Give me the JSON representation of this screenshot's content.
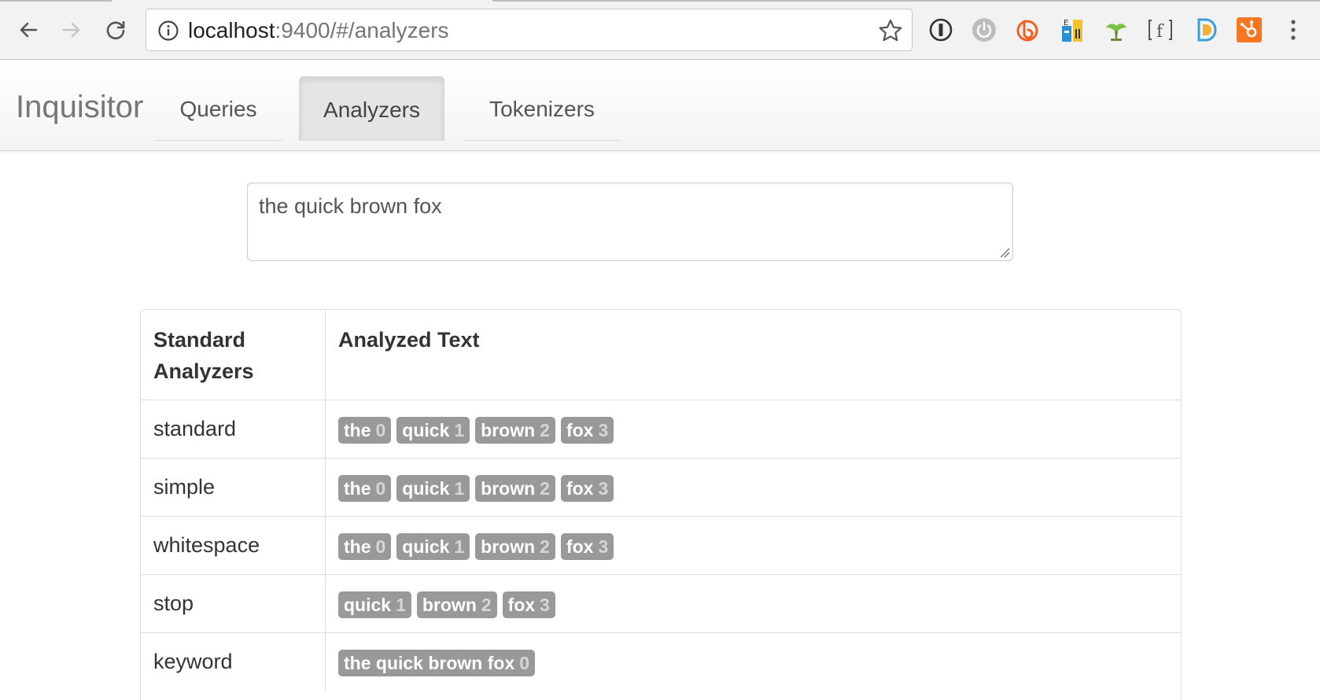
{
  "browser": {
    "url_host": "localhost",
    "url_rest": ":9400/#/analyzers"
  },
  "app": {
    "brand": "Inquisitor",
    "nav": [
      {
        "label": "Queries",
        "active": false
      },
      {
        "label": "Analyzers",
        "active": true
      },
      {
        "label": "Tokenizers",
        "active": false
      }
    ]
  },
  "query": {
    "text": "the quick brown fox"
  },
  "table": {
    "headers": [
      "Standard Analyzers",
      "Analyzed Text"
    ],
    "rows": [
      {
        "name": "standard",
        "tokens": [
          {
            "t": "the",
            "p": "0"
          },
          {
            "t": "quick",
            "p": "1"
          },
          {
            "t": "brown",
            "p": "2"
          },
          {
            "t": "fox",
            "p": "3"
          }
        ]
      },
      {
        "name": "simple",
        "tokens": [
          {
            "t": "the",
            "p": "0"
          },
          {
            "t": "quick",
            "p": "1"
          },
          {
            "t": "brown",
            "p": "2"
          },
          {
            "t": "fox",
            "p": "3"
          }
        ]
      },
      {
        "name": "whitespace",
        "tokens": [
          {
            "t": "the",
            "p": "0"
          },
          {
            "t": "quick",
            "p": "1"
          },
          {
            "t": "brown",
            "p": "2"
          },
          {
            "t": "fox",
            "p": "3"
          }
        ]
      },
      {
        "name": "stop",
        "tokens": [
          {
            "t": "quick",
            "p": "1"
          },
          {
            "t": "brown",
            "p": "2"
          },
          {
            "t": "fox",
            "p": "3"
          }
        ]
      },
      {
        "name": "keyword",
        "tokens": [
          {
            "t": "the quick brown fox",
            "p": "0"
          }
        ]
      }
    ]
  },
  "colors": {
    "token_bg": "#999999",
    "token_pos": "#d6d6d6",
    "active_tab_bg": "#e5e5e5"
  }
}
